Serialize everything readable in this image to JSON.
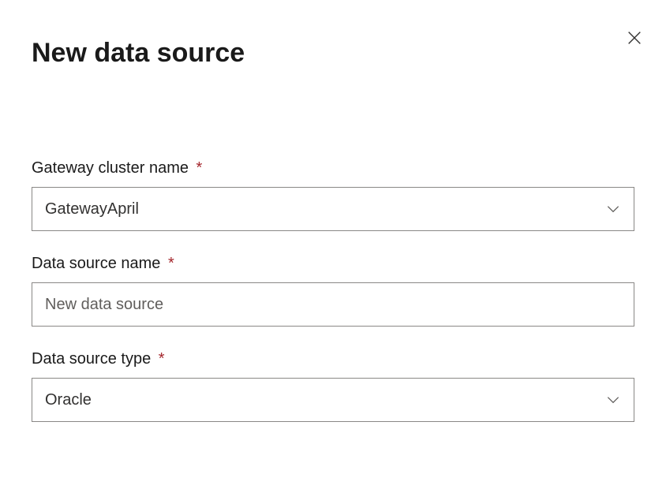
{
  "header": {
    "title": "New data source"
  },
  "form": {
    "gatewayCluster": {
      "label": "Gateway cluster name",
      "required": "*",
      "value": "GatewayApril"
    },
    "dataSourceName": {
      "label": "Data source name",
      "required": "*",
      "value": "New data source"
    },
    "dataSourceType": {
      "label": "Data source type",
      "required": "*",
      "value": "Oracle"
    }
  }
}
